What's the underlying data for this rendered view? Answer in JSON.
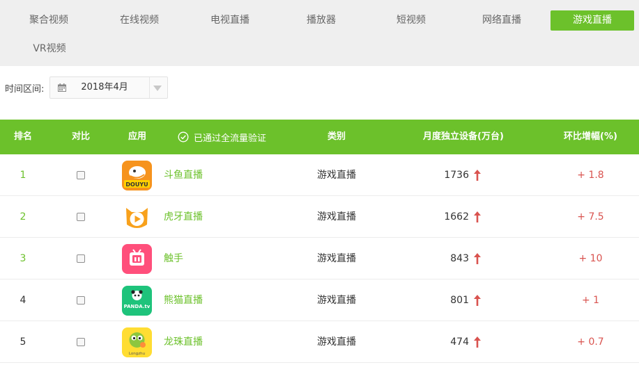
{
  "tabs": [
    {
      "label": "聚合视频",
      "active": false
    },
    {
      "label": "在线视频",
      "active": false
    },
    {
      "label": "电视直播",
      "active": false
    },
    {
      "label": "播放器",
      "active": false
    },
    {
      "label": "短视频",
      "active": false
    },
    {
      "label": "网络直播",
      "active": false
    },
    {
      "label": "游戏直播",
      "active": true
    },
    {
      "label": "VR视频",
      "active": false
    }
  ],
  "filter": {
    "label": "时间区间:",
    "date_value": "2018年4月",
    "icon": "calendar-icon"
  },
  "table": {
    "headers": {
      "rank": "排名",
      "compare": "对比",
      "app": "应用",
      "verified": "已通过全流量验证",
      "category": "类别",
      "devices": "月度独立设备(万台)",
      "change": "环比增幅(%)"
    },
    "rows": [
      {
        "rank": "1",
        "app": "斗鱼直播",
        "category": "游戏直播",
        "devices": "1736",
        "trend": "up",
        "change": "+ 1.8",
        "icon_text": "DOUYU"
      },
      {
        "rank": "2",
        "app": "虎牙直播",
        "category": "游戏直播",
        "devices": "1662",
        "trend": "up",
        "change": "+ 7.5",
        "icon_text": ""
      },
      {
        "rank": "3",
        "app": "触手",
        "category": "游戏直播",
        "devices": "843",
        "trend": "up",
        "change": "+ 10",
        "icon_text": ""
      },
      {
        "rank": "4",
        "app": "熊猫直播",
        "category": "游戏直播",
        "devices": "801",
        "trend": "up",
        "change": "+ 1",
        "icon_text": "PANDA.tv"
      },
      {
        "rank": "5",
        "app": "龙珠直播",
        "category": "游戏直播",
        "devices": "474",
        "trend": "up",
        "change": "+ 0.7",
        "icon_text": "Longzhu"
      }
    ]
  },
  "colors": {
    "accent": "#6cc12b",
    "tab_bar": "#efefef",
    "increase": "#d9534f"
  }
}
